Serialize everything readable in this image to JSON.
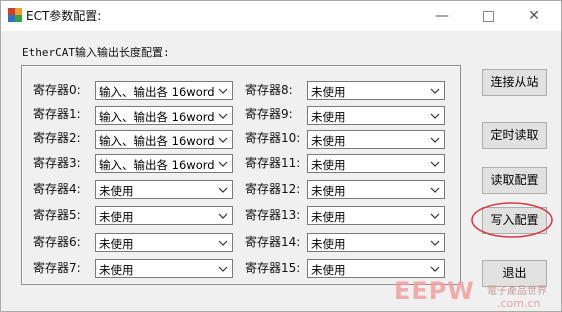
{
  "window": {
    "title": "ECT参数配置:",
    "minimize_glyph": "—",
    "close_glyph": "✕"
  },
  "section_label": "EtherCAT输入输出长度配置:",
  "registers_left": [
    {
      "label": "寄存器0:",
      "value": "输入、输出各 16word"
    },
    {
      "label": "寄存器1:",
      "value": "输入、输出各 16word"
    },
    {
      "label": "寄存器2:",
      "value": "输入、输出各 16word"
    },
    {
      "label": "寄存器3:",
      "value": "输入、输出各 16word"
    },
    {
      "label": "寄存器4:",
      "value": "未使用"
    },
    {
      "label": "寄存器5:",
      "value": "未使用"
    },
    {
      "label": "寄存器6:",
      "value": "未使用"
    },
    {
      "label": "寄存器7:",
      "value": "未使用"
    }
  ],
  "registers_right": [
    {
      "label": "寄存器8:",
      "value": "未使用"
    },
    {
      "label": "寄存器9:",
      "value": "未使用"
    },
    {
      "label": "寄存器10:",
      "value": "未使用"
    },
    {
      "label": "寄存器11:",
      "value": "未使用"
    },
    {
      "label": "寄存器12:",
      "value": "未使用"
    },
    {
      "label": "寄存器13:",
      "value": "未使用"
    },
    {
      "label": "寄存器14:",
      "value": "未使用"
    },
    {
      "label": "寄存器15:",
      "value": "未使用"
    }
  ],
  "buttons": {
    "connect_slave": "连接从站",
    "timed_read": "定时读取",
    "read_config": "读取配置",
    "write_config": "写入配置",
    "exit": "退出"
  },
  "watermark": {
    "logo": "EEPW",
    "sub": "電子產品世界",
    "url": ".com.cn"
  },
  "colors": {
    "highlight_ellipse": "#d9363e",
    "window_bg": "#f0f0f0",
    "button_bg": "#e1e1e1"
  },
  "icons": [
    "app-icon",
    "minimize-icon",
    "maximize-icon",
    "close-icon",
    "chevron-down-icon"
  ]
}
